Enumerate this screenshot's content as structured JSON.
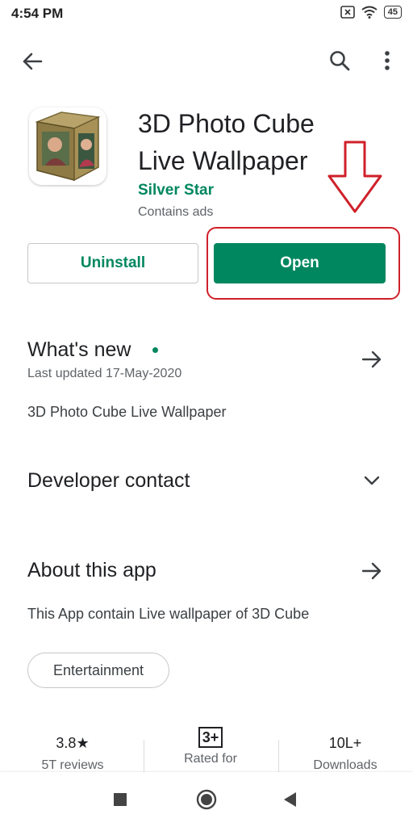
{
  "status_bar": {
    "time": "4:54 PM",
    "battery": "45"
  },
  "top_bar": {
    "back_icon": "arrow-back-icon",
    "search_icon": "search-icon",
    "more_icon": "more-vert-icon"
  },
  "app": {
    "title": "3D Photo Cube Live Wallpaper",
    "developer": "Silver Star",
    "ads_note": "Contains ads"
  },
  "actions": {
    "uninstall_label": "Uninstall",
    "open_label": "Open"
  },
  "whats_new": {
    "title": "What's new",
    "subtitle": "Last updated 17-May-2020",
    "body": "3D Photo Cube Live Wallpaper"
  },
  "developer_contact": {
    "title": "Developer contact"
  },
  "about": {
    "title": "About this app",
    "body": "This App contain Live wallpaper of 3D Cube",
    "category": "Entertainment"
  },
  "stats": {
    "rating": "3.8",
    "rating_star": "★",
    "reviews": "5T reviews",
    "age_badge": "3+",
    "age_label": "Rated for",
    "downloads": "10L+",
    "downloads_label": "Downloads"
  },
  "colors": {
    "brand_green": "#01875f",
    "annotation_red": "#d0202a"
  }
}
